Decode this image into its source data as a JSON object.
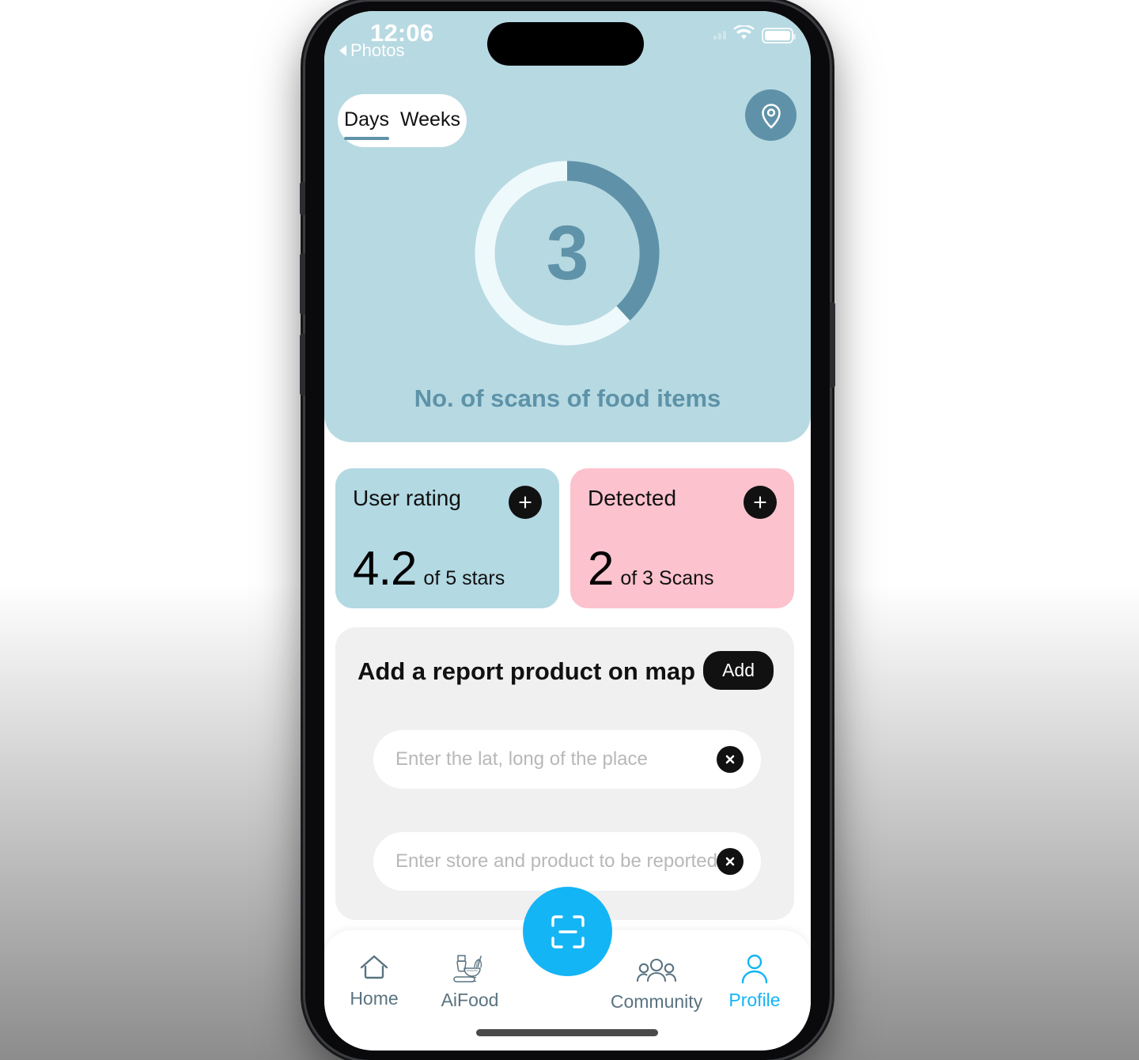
{
  "status_bar": {
    "time": "12:06",
    "back_label": "Photos",
    "icons": [
      "signal-icon",
      "wifi-icon",
      "battery-icon"
    ]
  },
  "header": {
    "segmented": {
      "options": [
        "Days",
        "Weeks"
      ],
      "selected": "Days"
    },
    "location_button_icon": "location-pin-icon"
  },
  "chart_data": {
    "type": "pie",
    "title": "No. of scans of food items",
    "center_value": "3",
    "slices": [
      {
        "name": "scans",
        "value": 3,
        "percent": 38,
        "color": "#5f92a8"
      },
      {
        "name": "remaining",
        "value": 5,
        "percent": 62,
        "color": "#eef9fb"
      }
    ],
    "total": 8,
    "track_color": "#eef9fb",
    "accent_color": "#5f92a8",
    "card_background": "#b7d9e2",
    "start_angle_deg": 0,
    "sweep_deg": 137
  },
  "stats": [
    {
      "key": "user-rating",
      "title": "User rating",
      "value": "4.2",
      "suffix": "of 5 stars",
      "background": "#b3d9e3",
      "add_icon": "plus-icon"
    },
    {
      "key": "detected",
      "title": "Detected",
      "value": "2",
      "suffix": "of 3 Scans",
      "background": "#fcc2ce",
      "add_icon": "plus-icon"
    }
  ],
  "report": {
    "title": "Add a report product on map",
    "add_label": "Add",
    "fields": [
      {
        "key": "latlong",
        "value": "",
        "placeholder": "Enter the lat, long of the place",
        "clear_icon": "close-circle-icon"
      },
      {
        "key": "store",
        "value": "",
        "placeholder": "Enter store and product to be reported",
        "clear_icon": "close-circle-icon"
      }
    ]
  },
  "bottom_nav": {
    "items": [
      {
        "key": "home",
        "label": "Home",
        "icon": "home-icon",
        "active": false
      },
      {
        "key": "aifood",
        "label": "AiFood",
        "icon": "cooking-bowl-whisk-icon",
        "active": false
      },
      {
        "key": "community",
        "label": "Community",
        "icon": "people-group-icon",
        "active": false
      },
      {
        "key": "profile",
        "label": "Profile",
        "icon": "person-icon",
        "active": true
      }
    ],
    "fab": {
      "icon": "scan-frame-icon",
      "color": "#14b5f5"
    },
    "active_color": "#14b5f5",
    "inactive_color": "#5a7380"
  }
}
